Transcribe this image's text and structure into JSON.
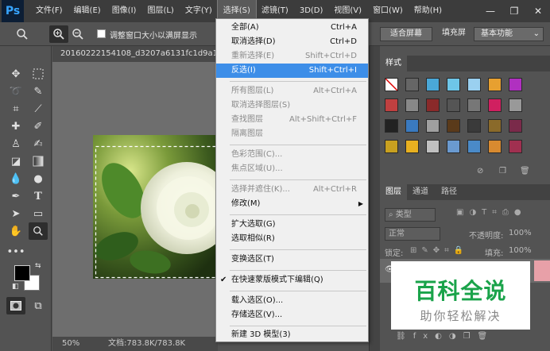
{
  "app": {
    "logo": "Ps"
  },
  "menubar": {
    "items": [
      "文件(F)",
      "编辑(E)",
      "图像(I)",
      "图层(L)",
      "文字(Y)",
      "选择(S)",
      "滤镜(T)",
      "3D(D)",
      "视图(V)",
      "窗口(W)",
      "帮助(H)"
    ],
    "active": "选择(S)"
  },
  "window_controls": {
    "minimize": "—",
    "restore": "❐",
    "close": "✕"
  },
  "options_bar": {
    "resize_windows_label": "调整窗口大小以满屏显示",
    "fit_screen_button": "适合屏幕",
    "fill_screen_button": "填充屏",
    "workspace_select": "基本功能"
  },
  "document": {
    "tab_title": "20160222154108_d3207a6131fc1d9a1ac",
    "zoom": "50%",
    "doc_info": "文档:783.8K/783.8K"
  },
  "select_menu": {
    "items": [
      {
        "label": "全部(A)",
        "shortcut": "Ctrl+A",
        "disabled": false
      },
      {
        "label": "取消选择(D)",
        "shortcut": "Ctrl+D",
        "disabled": false
      },
      {
        "label": "重新选择(E)",
        "shortcut": "Shift+Ctrl+D",
        "disabled": true
      },
      {
        "label": "反选(I)",
        "shortcut": "Shift+Ctrl+I",
        "disabled": false,
        "highlighted": true
      },
      {
        "label": "所有图层(L)",
        "shortcut": "Alt+Ctrl+A",
        "disabled": true
      },
      {
        "label": "取消选择图层(S)",
        "shortcut": "",
        "disabled": true
      },
      {
        "label": "查找图层",
        "shortcut": "Alt+Shift+Ctrl+F",
        "disabled": true
      },
      {
        "label": "隔离图层",
        "shortcut": "",
        "disabled": true
      },
      {
        "label": "色彩范围(C)...",
        "shortcut": "",
        "disabled": true
      },
      {
        "label": "焦点区域(U)...",
        "shortcut": "",
        "disabled": true
      },
      {
        "label": "选择并遮住(K)...",
        "shortcut": "Alt+Ctrl+R",
        "disabled": true
      },
      {
        "label": "修改(M)",
        "shortcut": "",
        "disabled": false,
        "submenu": true
      },
      {
        "label": "扩大选取(G)",
        "shortcut": "",
        "disabled": false
      },
      {
        "label": "选取相似(R)",
        "shortcut": "",
        "disabled": false
      },
      {
        "label": "变换选区(T)",
        "shortcut": "",
        "disabled": false
      },
      {
        "label": "在快速蒙版模式下编辑(Q)",
        "shortcut": "",
        "disabled": false,
        "checked": true
      },
      {
        "label": "载入选区(O)...",
        "shortcut": "",
        "disabled": false
      },
      {
        "label": "存储选区(V)...",
        "shortcut": "",
        "disabled": false
      },
      {
        "label": "新建 3D 模型(3)",
        "shortcut": "",
        "disabled": false
      }
    ]
  },
  "styles_panel": {
    "tab": "样式"
  },
  "layers_panel": {
    "tabs": [
      "图层",
      "通道",
      "路径"
    ],
    "filter_label": "类型",
    "blend_mode": "正常",
    "opacity_label": "不透明度:",
    "opacity_value": "100%",
    "lock_label": "锁定:",
    "fill_label": "填充:",
    "fill_value": "100%"
  },
  "watermark": {
    "title": "百科全说",
    "subtitle": "助你轻松解决"
  },
  "colors": {
    "highlight": "#3d8ee8",
    "watermark_green": "#1aa34a"
  }
}
